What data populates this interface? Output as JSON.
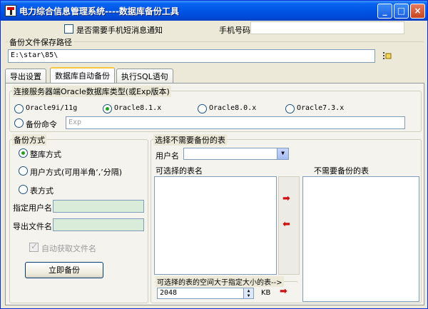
{
  "window": {
    "title": "电力综合信息管理系统----数据库备份工具"
  },
  "titlebar": {
    "minimize": "_",
    "maximize": "□",
    "close": "×"
  },
  "sms": {
    "checkbox_label": "是否需要手机短消息通知",
    "phone_label": "手机号码",
    "phone_value": ""
  },
  "backup_path": {
    "legend": "备份文件保存路径",
    "value": "E:\\star\\85\\"
  },
  "tabs": [
    {
      "label": "导出设置",
      "active": false
    },
    {
      "label": "数据库自动备份",
      "active": true
    },
    {
      "label": "执行SQL语句",
      "active": false
    }
  ],
  "oracle": {
    "legend": "连接服务器端Oracle数据库类型(或Exp版本)",
    "options": [
      "Oracle9i/11g",
      "Oracle8.1.x",
      "Oracle8.0.x",
      "Oracle7.3.x"
    ],
    "selected": "Oracle8.1.x",
    "cmd_label": "备份命令",
    "cmd_placeholder": "Exp"
  },
  "backup_mode": {
    "legend": "备份方式",
    "options": [
      "整库方式",
      "用户方式(可用半角‘,’分隔)",
      "表方式"
    ],
    "selected": "整库方式",
    "user_label": "指定用户名",
    "user_value": "",
    "file_label": "导出文件名",
    "file_value": "",
    "auto_name_label": "自动获取文件名",
    "auto_name_checked": true,
    "backup_button": "立即备份"
  },
  "exclude": {
    "legend": "选择不需要备份的表",
    "user_label": "用户名",
    "user_value": "",
    "available_label": "可选择的表名",
    "excluded_label": "不需要备份的表",
    "space_label": "可选择的表的空间大于指定大小的表-->",
    "space_value": "2048",
    "space_unit": "KB"
  },
  "colors": {
    "title_blue": "#0055e5",
    "accent_green": "#21a121",
    "arrow_red": "#cc1111"
  }
}
